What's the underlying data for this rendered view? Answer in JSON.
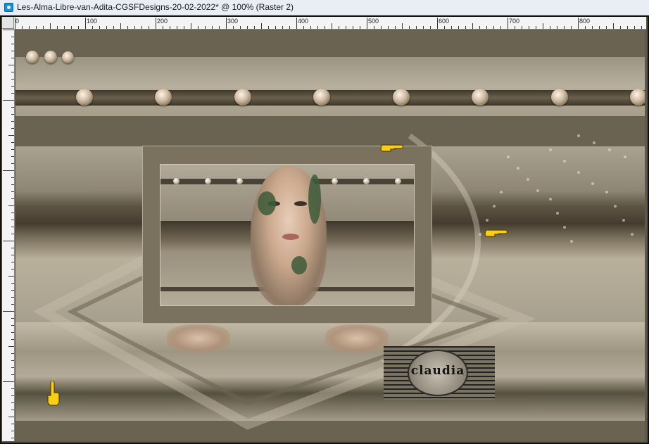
{
  "window": {
    "title": "Les-Alma-Libre-van-Adita-CGSFDesigns-20-02-2022* @ 100% (Raster 2)"
  },
  "ruler": {
    "top_labels": [
      "0",
      "100",
      "200",
      "300",
      "400",
      "500",
      "600",
      "700",
      "800"
    ]
  },
  "artwork": {
    "watermark_text": "claudia",
    "pointer_hands": [
      "pointing-hand-right",
      "pointing-hand-right",
      "pointing-hand-up"
    ]
  },
  "colors": {
    "background": "#6b6453",
    "title_bar": "#e9eef5",
    "ruler": "#f4f4f4",
    "taupe": "#b0a794",
    "hand_yellow": "#f6cf16"
  }
}
